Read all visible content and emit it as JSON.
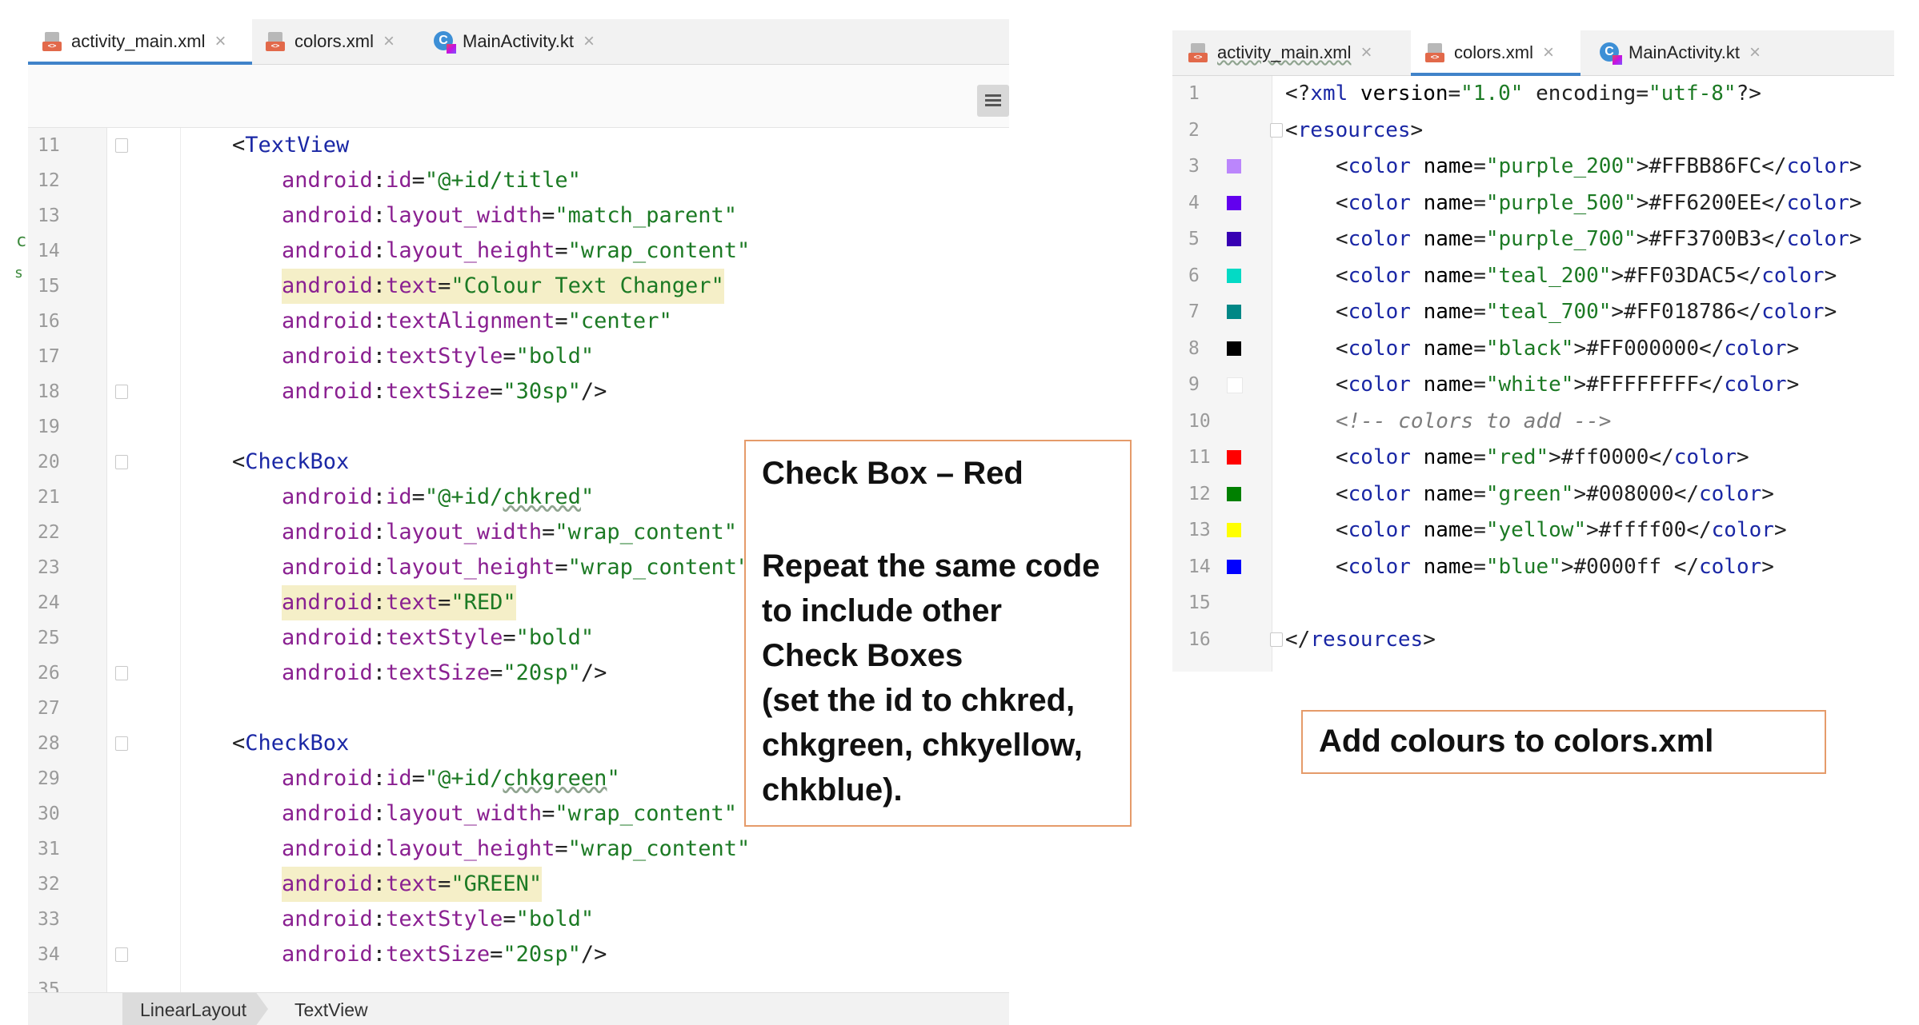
{
  "left_editor": {
    "tabs": [
      {
        "label": "activity_main.xml",
        "icon": "xml-file-icon",
        "active": true
      },
      {
        "label": "colors.xml",
        "icon": "xml-file-icon",
        "active": false
      },
      {
        "label": "MainActivity.kt",
        "icon": "kotlin-file-icon",
        "active": false
      }
    ],
    "lines": [
      {
        "num": "11",
        "code": "<TextView"
      },
      {
        "num": "12",
        "code": "android:id=\"@+id/title\""
      },
      {
        "num": "13",
        "code": "android:layout_width=\"match_parent\""
      },
      {
        "num": "14",
        "code": "android:layout_height=\"wrap_content\""
      },
      {
        "num": "15",
        "code": "android:text=\"Colour Text Changer\""
      },
      {
        "num": "16",
        "code": "android:textAlignment=\"center\""
      },
      {
        "num": "17",
        "code": "android:textStyle=\"bold\""
      },
      {
        "num": "18",
        "code": "android:textSize=\"30sp\"/>"
      },
      {
        "num": "19",
        "code": ""
      },
      {
        "num": "20",
        "code": "<CheckBox"
      },
      {
        "num": "21",
        "code": "android:id=\"@+id/chkred\""
      },
      {
        "num": "22",
        "code": "android:layout_width=\"wrap_content\""
      },
      {
        "num": "23",
        "code": "android:layout_height=\"wrap_content\""
      },
      {
        "num": "24",
        "code": "android:text=\"RED\""
      },
      {
        "num": "25",
        "code": "android:textStyle=\"bold\""
      },
      {
        "num": "26",
        "code": "android:textSize=\"20sp\"/>"
      },
      {
        "num": "27",
        "code": ""
      },
      {
        "num": "28",
        "code": "<CheckBox"
      },
      {
        "num": "29",
        "code": "android:id=\"@+id/chkgreen\""
      },
      {
        "num": "30",
        "code": "android:layout_width=\"wrap_content\""
      },
      {
        "num": "31",
        "code": "android:layout_height=\"wrap_content\""
      },
      {
        "num": "32",
        "code": "android:text=\"GREEN\""
      },
      {
        "num": "33",
        "code": "android:textStyle=\"bold\""
      },
      {
        "num": "34",
        "code": "android:textSize=\"20sp\"/>"
      },
      {
        "num": "35",
        "code": ""
      }
    ],
    "breadcrumb": [
      "LinearLayout",
      "TextView"
    ],
    "gutter_marks": {
      "14": "c",
      "15": "s"
    }
  },
  "right_editor": {
    "tabs": [
      {
        "label": "activity_main.xml",
        "icon": "xml-file-icon",
        "active": false
      },
      {
        "label": "colors.xml",
        "icon": "xml-file-icon",
        "active": true
      },
      {
        "label": "MainActivity.kt",
        "icon": "kotlin-file-icon",
        "active": false
      }
    ],
    "lines": [
      {
        "num": "1",
        "code": "<?xml version=\"1.0\" encoding=\"utf-8\"?>",
        "swatch": null
      },
      {
        "num": "2",
        "code": "<resources>",
        "swatch": null
      },
      {
        "num": "3",
        "code": "<color name=\"purple_200\">#FFBB86FC</color>",
        "swatch": "#BB86FC"
      },
      {
        "num": "4",
        "code": "<color name=\"purple_500\">#FF6200EE</color>",
        "swatch": "#6200EE"
      },
      {
        "num": "5",
        "code": "<color name=\"purple_700\">#FF3700B3</color>",
        "swatch": "#3700B3"
      },
      {
        "num": "6",
        "code": "<color name=\"teal_200\">#FF03DAC5</color>",
        "swatch": "#03DAC5"
      },
      {
        "num": "7",
        "code": "<color name=\"teal_700\">#FF018786</color>",
        "swatch": "#018786"
      },
      {
        "num": "8",
        "code": "<color name=\"black\">#FF000000</color>",
        "swatch": "#000000"
      },
      {
        "num": "9",
        "code": "<color name=\"white\">#FFFFFFFF</color>",
        "swatch": "#FFFFFF"
      },
      {
        "num": "10",
        "code": "<!-- colors to add -->",
        "swatch": null
      },
      {
        "num": "11",
        "code": "<color name=\"red\">#ff0000</color>",
        "swatch": "#ff0000"
      },
      {
        "num": "12",
        "code": "<color name=\"green\">#008000</color>",
        "swatch": "#008000"
      },
      {
        "num": "13",
        "code": "<color name=\"yellow\">#ffff00</color>",
        "swatch": "#ffff00"
      },
      {
        "num": "14",
        "code": "<color name=\"blue\">#0000ff </color>",
        "swatch": "#0000ff"
      },
      {
        "num": "15",
        "code": "",
        "swatch": null
      },
      {
        "num": "16",
        "code": "</resources>",
        "swatch": null
      }
    ]
  },
  "callouts": {
    "checkbox": {
      "heading": "Check Box – Red",
      "body": [
        "Repeat the same code",
        "to include other",
        "Check Boxes",
        "(set the id to chkred,",
        "chkgreen, chkyellow,",
        "chkblue)."
      ]
    },
    "colors": {
      "text": "Add colours to colors.xml"
    }
  },
  "colors": {
    "accent_tab": "#4083c9",
    "callout_border": "#e59b6a",
    "highlight": "#f5efc8"
  }
}
